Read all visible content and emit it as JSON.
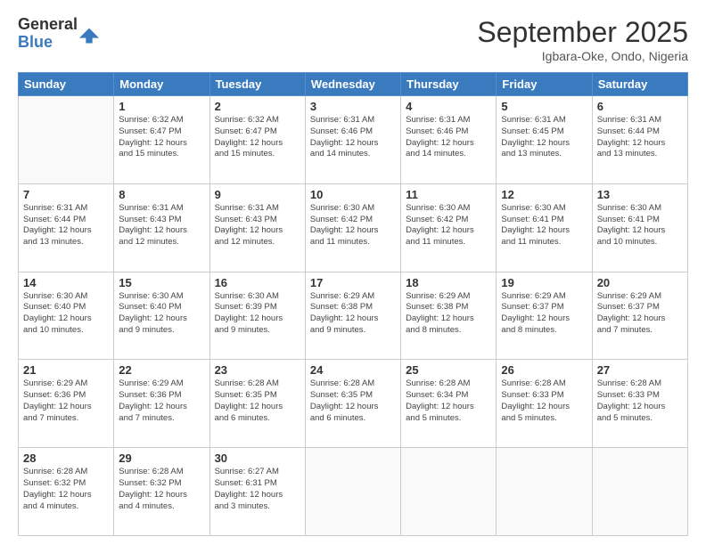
{
  "header": {
    "logo_line1": "General",
    "logo_line2": "Blue",
    "month": "September 2025",
    "location": "Igbara-Oke, Ondo, Nigeria"
  },
  "weekdays": [
    "Sunday",
    "Monday",
    "Tuesday",
    "Wednesday",
    "Thursday",
    "Friday",
    "Saturday"
  ],
  "weeks": [
    [
      {
        "day": "",
        "info": ""
      },
      {
        "day": "1",
        "info": "Sunrise: 6:32 AM\nSunset: 6:47 PM\nDaylight: 12 hours\nand 15 minutes."
      },
      {
        "day": "2",
        "info": "Sunrise: 6:32 AM\nSunset: 6:47 PM\nDaylight: 12 hours\nand 15 minutes."
      },
      {
        "day": "3",
        "info": "Sunrise: 6:31 AM\nSunset: 6:46 PM\nDaylight: 12 hours\nand 14 minutes."
      },
      {
        "day": "4",
        "info": "Sunrise: 6:31 AM\nSunset: 6:46 PM\nDaylight: 12 hours\nand 14 minutes."
      },
      {
        "day": "5",
        "info": "Sunrise: 6:31 AM\nSunset: 6:45 PM\nDaylight: 12 hours\nand 13 minutes."
      },
      {
        "day": "6",
        "info": "Sunrise: 6:31 AM\nSunset: 6:44 PM\nDaylight: 12 hours\nand 13 minutes."
      }
    ],
    [
      {
        "day": "7",
        "info": "Sunrise: 6:31 AM\nSunset: 6:44 PM\nDaylight: 12 hours\nand 13 minutes."
      },
      {
        "day": "8",
        "info": "Sunrise: 6:31 AM\nSunset: 6:43 PM\nDaylight: 12 hours\nand 12 minutes."
      },
      {
        "day": "9",
        "info": "Sunrise: 6:31 AM\nSunset: 6:43 PM\nDaylight: 12 hours\nand 12 minutes."
      },
      {
        "day": "10",
        "info": "Sunrise: 6:30 AM\nSunset: 6:42 PM\nDaylight: 12 hours\nand 11 minutes."
      },
      {
        "day": "11",
        "info": "Sunrise: 6:30 AM\nSunset: 6:42 PM\nDaylight: 12 hours\nand 11 minutes."
      },
      {
        "day": "12",
        "info": "Sunrise: 6:30 AM\nSunset: 6:41 PM\nDaylight: 12 hours\nand 11 minutes."
      },
      {
        "day": "13",
        "info": "Sunrise: 6:30 AM\nSunset: 6:41 PM\nDaylight: 12 hours\nand 10 minutes."
      }
    ],
    [
      {
        "day": "14",
        "info": "Sunrise: 6:30 AM\nSunset: 6:40 PM\nDaylight: 12 hours\nand 10 minutes."
      },
      {
        "day": "15",
        "info": "Sunrise: 6:30 AM\nSunset: 6:40 PM\nDaylight: 12 hours\nand 9 minutes."
      },
      {
        "day": "16",
        "info": "Sunrise: 6:30 AM\nSunset: 6:39 PM\nDaylight: 12 hours\nand 9 minutes."
      },
      {
        "day": "17",
        "info": "Sunrise: 6:29 AM\nSunset: 6:38 PM\nDaylight: 12 hours\nand 9 minutes."
      },
      {
        "day": "18",
        "info": "Sunrise: 6:29 AM\nSunset: 6:38 PM\nDaylight: 12 hours\nand 8 minutes."
      },
      {
        "day": "19",
        "info": "Sunrise: 6:29 AM\nSunset: 6:37 PM\nDaylight: 12 hours\nand 8 minutes."
      },
      {
        "day": "20",
        "info": "Sunrise: 6:29 AM\nSunset: 6:37 PM\nDaylight: 12 hours\nand 7 minutes."
      }
    ],
    [
      {
        "day": "21",
        "info": "Sunrise: 6:29 AM\nSunset: 6:36 PM\nDaylight: 12 hours\nand 7 minutes."
      },
      {
        "day": "22",
        "info": "Sunrise: 6:29 AM\nSunset: 6:36 PM\nDaylight: 12 hours\nand 7 minutes."
      },
      {
        "day": "23",
        "info": "Sunrise: 6:28 AM\nSunset: 6:35 PM\nDaylight: 12 hours\nand 6 minutes."
      },
      {
        "day": "24",
        "info": "Sunrise: 6:28 AM\nSunset: 6:35 PM\nDaylight: 12 hours\nand 6 minutes."
      },
      {
        "day": "25",
        "info": "Sunrise: 6:28 AM\nSunset: 6:34 PM\nDaylight: 12 hours\nand 5 minutes."
      },
      {
        "day": "26",
        "info": "Sunrise: 6:28 AM\nSunset: 6:33 PM\nDaylight: 12 hours\nand 5 minutes."
      },
      {
        "day": "27",
        "info": "Sunrise: 6:28 AM\nSunset: 6:33 PM\nDaylight: 12 hours\nand 5 minutes."
      }
    ],
    [
      {
        "day": "28",
        "info": "Sunrise: 6:28 AM\nSunset: 6:32 PM\nDaylight: 12 hours\nand 4 minutes."
      },
      {
        "day": "29",
        "info": "Sunrise: 6:28 AM\nSunset: 6:32 PM\nDaylight: 12 hours\nand 4 minutes."
      },
      {
        "day": "30",
        "info": "Sunrise: 6:27 AM\nSunset: 6:31 PM\nDaylight: 12 hours\nand 3 minutes."
      },
      {
        "day": "",
        "info": ""
      },
      {
        "day": "",
        "info": ""
      },
      {
        "day": "",
        "info": ""
      },
      {
        "day": "",
        "info": ""
      }
    ]
  ]
}
